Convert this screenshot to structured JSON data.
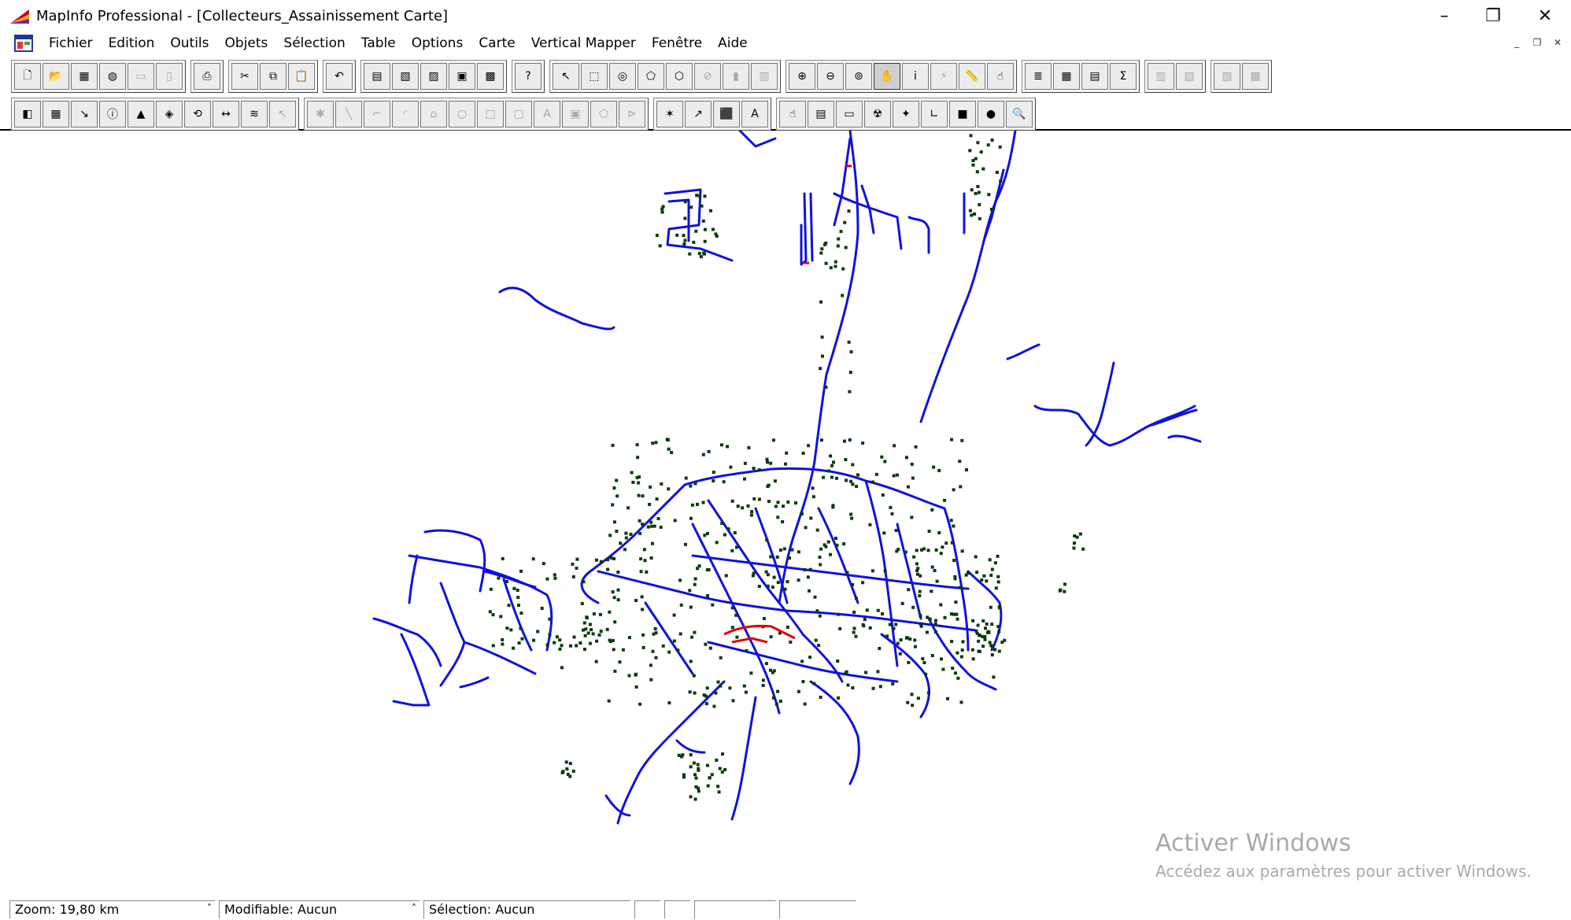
{
  "window": {
    "title": "MapInfo Professional - [Collecteurs_Assainissement Carte]",
    "controls": {
      "minimize": "–",
      "restore": "❐",
      "close": "✕"
    }
  },
  "menu": {
    "items": [
      "Fichier",
      "Edition",
      "Outils",
      "Objets",
      "Sélection",
      "Table",
      "Options",
      "Carte",
      "Vertical Mapper",
      "Fenêtre",
      "Aide"
    ],
    "mdi_controls": [
      "_",
      "❐",
      "✕"
    ]
  },
  "toolbar1": {
    "groups": [
      [
        "new-icon",
        "open-icon",
        "open-workspace-icon",
        "open-dbms-icon",
        "save-icon",
        "close-table-icon"
      ],
      [
        "print-icon"
      ],
      [
        "cut-icon",
        "copy-icon",
        "paste-icon"
      ],
      [
        "undo-icon"
      ],
      [
        "new-browser-icon",
        "new-mapper-icon",
        "new-grapher-icon",
        "new-layout-icon",
        "new-redistrict-icon"
      ],
      [
        "help-icon"
      ],
      [
        "select-icon",
        "marquee-select-icon",
        "radius-select-icon",
        "polygon-select-icon",
        "boundary-select-icon",
        "unselect-all-icon",
        "invert-selection-icon",
        "graph-select-icon"
      ],
      [
        "zoom-in-icon",
        "zoom-out-icon",
        "change-view-icon",
        "grabber-icon",
        "info-icon",
        "hotlink-icon",
        "ruler-icon",
        "drag-window-icon"
      ],
      [
        "layer-control-icon",
        "show-legend-icon",
        "statistics-icon",
        "sum-icon"
      ],
      [
        "legend-icon",
        "cartographic-legend-icon"
      ],
      [
        "options-icon",
        "clip-region-icon"
      ]
    ],
    "glyphs": {
      "new-icon": "🗋",
      "open-icon": "📂",
      "open-workspace-icon": "▦",
      "open-dbms-icon": "◍",
      "save-icon": "▭",
      "close-table-icon": "▯",
      "print-icon": "⎙",
      "cut-icon": "✂",
      "copy-icon": "⧉",
      "paste-icon": "📋",
      "undo-icon": "↶",
      "new-browser-icon": "▤",
      "new-mapper-icon": "▧",
      "new-grapher-icon": "▨",
      "new-layout-icon": "▣",
      "new-redistrict-icon": "▩",
      "help-icon": "?",
      "select-icon": "↖",
      "marquee-select-icon": "⬚",
      "radius-select-icon": "◎",
      "polygon-select-icon": "⬠",
      "boundary-select-icon": "⬡",
      "unselect-all-icon": "⊘",
      "invert-selection-icon": "▮",
      "graph-select-icon": "▥",
      "zoom-in-icon": "⊕",
      "zoom-out-icon": "⊖",
      "change-view-icon": "⊚",
      "grabber-icon": "✋",
      "info-icon": "i",
      "hotlink-icon": "⚡",
      "ruler-icon": "📏",
      "drag-window-icon": "☝",
      "layer-control-icon": "≣",
      "show-legend-icon": "▦",
      "statistics-icon": "▤",
      "sum-icon": "Σ",
      "legend-icon": "▥",
      "cartographic-legend-icon": "▧",
      "options-icon": "▨",
      "clip-region-icon": "▩"
    },
    "dim": [
      "save-icon",
      "close-table-icon",
      "paste-icon",
      "unselect-all-icon",
      "invert-selection-icon",
      "graph-select-icon",
      "hotlink-icon",
      "legend-icon",
      "cartographic-legend-icon",
      "options-icon",
      "clip-region-icon"
    ]
  },
  "toolbar2": {
    "groups": [
      [
        "thematic-map-icon",
        "grid-icon",
        "profile-icon",
        "info-tool-icon",
        "surface-icon",
        "contour-icon",
        "rotate-icon",
        "offset-icon",
        "layers-icon",
        "pointer-icon"
      ],
      [
        "symbol-icon",
        "line-icon",
        "polyline-icon",
        "arc-icon",
        "polygon-icon",
        "ellipse-icon",
        "rectangle-icon",
        "rounded-rect-icon",
        "text-icon",
        "frame-icon",
        "reshape-icon",
        "add-node-icon"
      ],
      [
        "symbol-style-icon",
        "line-style-icon",
        "region-style-icon",
        "text-style-icon"
      ],
      [
        "select-by-tool-icon",
        "window-icon",
        "frame-tool-icon",
        "radioactive-icon",
        "pin-icon",
        "corner-icon",
        "square-icon",
        "circle-icon",
        "search-icon"
      ]
    ],
    "glyphs": {
      "thematic-map-icon": "◧",
      "grid-icon": "▦",
      "profile-icon": "↘",
      "info-tool-icon": "ⓘ",
      "surface-icon": "▲",
      "contour-icon": "◈",
      "rotate-icon": "⟲",
      "offset-icon": "↔",
      "layers-icon": "≋",
      "pointer-icon": "↖",
      "symbol-icon": "✱",
      "line-icon": "╲",
      "polyline-icon": "⌐",
      "arc-icon": "◜",
      "polygon-icon": "⌂",
      "ellipse-icon": "○",
      "rectangle-icon": "□",
      "rounded-rect-icon": "▢",
      "text-icon": "A",
      "frame-icon": "▣",
      "reshape-icon": "⬠",
      "add-node-icon": "⊳",
      "symbol-style-icon": "✶",
      "line-style-icon": "↗",
      "region-style-icon": "⬛",
      "text-style-icon": "A",
      "select-by-tool-icon": "☝",
      "window-icon": "▤",
      "frame-tool-icon": "▭",
      "radioactive-icon": "☢",
      "pin-icon": "✦",
      "corner-icon": "∟",
      "square-icon": "■",
      "circle-icon": "●",
      "search-icon": "🔍"
    },
    "dim": [
      "symbol-icon",
      "line-icon",
      "polyline-icon",
      "arc-icon",
      "polygon-icon",
      "ellipse-icon",
      "rectangle-icon",
      "rounded-rect-icon",
      "text-icon",
      "frame-icon",
      "reshape-icon",
      "add-node-icon",
      "pointer-icon"
    ]
  },
  "map": {
    "pipe_color": "#1010e0",
    "node_color": "#0b3a0b",
    "highlight_color": "#e00000"
  },
  "watermark": {
    "line1": "Activer Windows",
    "line2": "Accédez aux paramètres pour activer Windows."
  },
  "status": {
    "zoom": "Zoom: 19,80 km",
    "editable": "Modifiable: Aucun",
    "selection": "Sélection: Aucun"
  }
}
